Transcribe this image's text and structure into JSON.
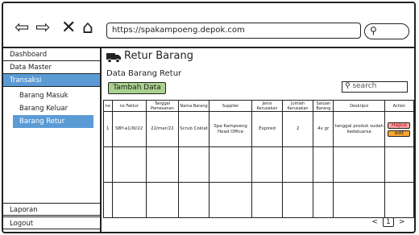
{
  "browser": {
    "url": "https://spakampoeng.depok.com"
  },
  "sidebar": {
    "items": [
      {
        "label": "Dashboard"
      },
      {
        "label": "Data Master"
      },
      {
        "label": "Transaksi"
      },
      {
        "label": "Barang Masuk"
      },
      {
        "label": "Barang Keluar"
      },
      {
        "label": "Barang Retur"
      },
      {
        "label": "Laporan"
      },
      {
        "label": "Logout"
      }
    ]
  },
  "main": {
    "title": "Retur Barang",
    "subtitle": "Data Barang Retur",
    "add_button": "Tambah Data",
    "search_placeholder": "search"
  },
  "table": {
    "headers": [
      "no",
      "no Faktur",
      "Tanggal Pemesanan",
      "Nama Barang",
      "Supplier",
      "Jenis Kerusakan",
      "Jumlah Kerusakan",
      "Satuan Barang",
      "Deskripsi",
      "Action"
    ],
    "rows": [
      [
        "1",
        "SBY-a1/III/22",
        "22/mar/22",
        "Scrub Coklat",
        "Spa Kampoeng Head Office",
        "Expired",
        "2",
        "4v gr",
        "tanggal produk sudah kedaluarsa"
      ]
    ],
    "actions": {
      "delete": "Hapus",
      "edit": "edit"
    }
  },
  "pagination": {
    "prev": "<",
    "current": "1",
    "next": ">"
  }
}
